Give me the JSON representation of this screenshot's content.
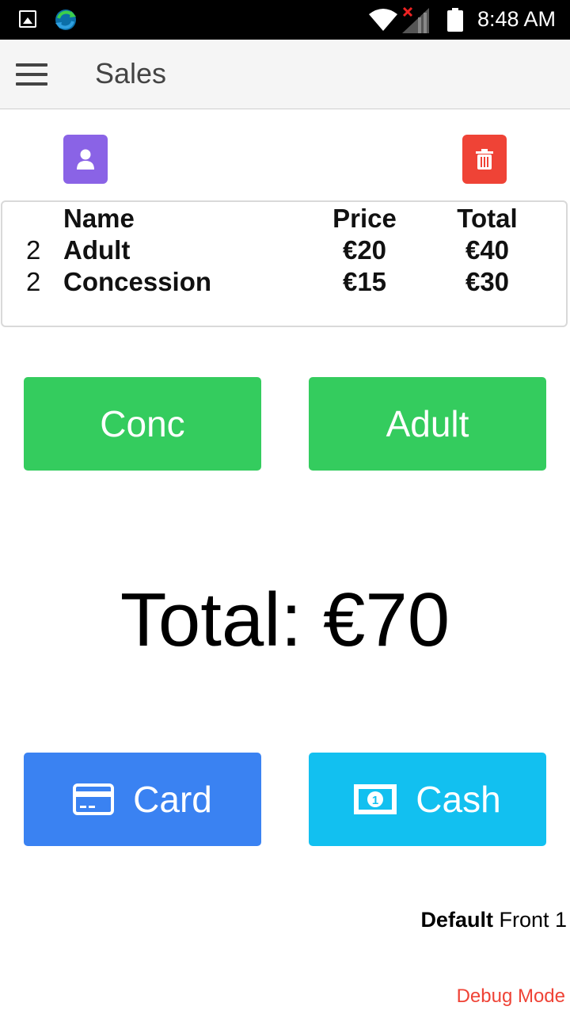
{
  "status_bar": {
    "time": "8:48 AM",
    "icons": [
      "gallery-icon",
      "sync-icon",
      "wifi-icon",
      "signal-no-service-icon",
      "battery-icon"
    ]
  },
  "app_bar": {
    "title": "Sales",
    "menu_icon": "hamburger-menu-icon"
  },
  "actions": {
    "customer_icon": "user-icon",
    "customer_color": "#8a63e6",
    "clear_icon": "trash-icon",
    "clear_color": "#ef4336"
  },
  "order": {
    "headers": {
      "qty": "",
      "name": "Name",
      "price": "Price",
      "total": "Total"
    },
    "rows": [
      {
        "qty": "2",
        "name": "Adult",
        "price": "€20",
        "total": "€40"
      },
      {
        "qty": "2",
        "name": "Concession",
        "price": "€15",
        "total": "€30"
      }
    ]
  },
  "products": {
    "conc_label": "Conc",
    "adult_label": "Adult",
    "color": "#34cc5e"
  },
  "total_text": "Total: €70",
  "payment": {
    "card_label": "Card",
    "card_icon": "credit-card-icon",
    "card_color": "#3a82f2",
    "cash_label": "Cash",
    "cash_icon": "banknote-icon",
    "cash_color": "#12c0f0"
  },
  "footer": {
    "location_bold": "Default",
    "location_rest": " Front 1",
    "debug_label": "Debug Mode"
  }
}
